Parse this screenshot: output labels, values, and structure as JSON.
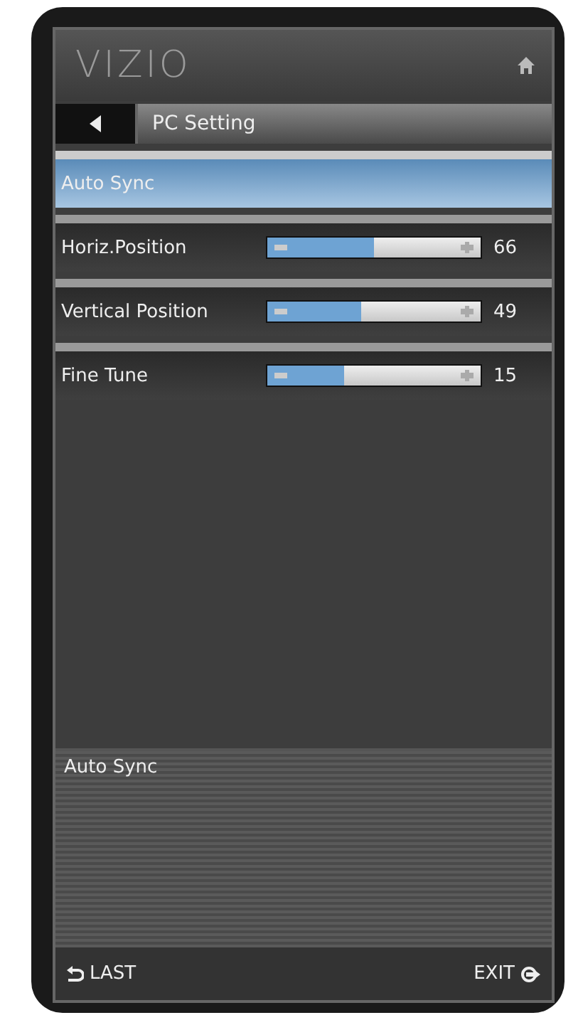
{
  "header": {
    "logo": "VIZIO"
  },
  "title_bar": {
    "title": "PC Setting"
  },
  "items": [
    {
      "kind": "action",
      "label": "Auto Sync",
      "selected": true
    },
    {
      "kind": "slider",
      "label": "Horiz.Position",
      "selected": false,
      "level": 0.5,
      "reading": "66"
    },
    {
      "kind": "slider",
      "label": "Vertical Position",
      "selected": false,
      "level": 0.44,
      "reading": "49"
    },
    {
      "kind": "slider",
      "label": "Fine Tune",
      "selected": false,
      "level": 0.36,
      "reading": "15"
    }
  ],
  "help": {
    "text": "Auto Sync"
  },
  "footer": {
    "last": "LAST",
    "exit": "EXIT"
  }
}
